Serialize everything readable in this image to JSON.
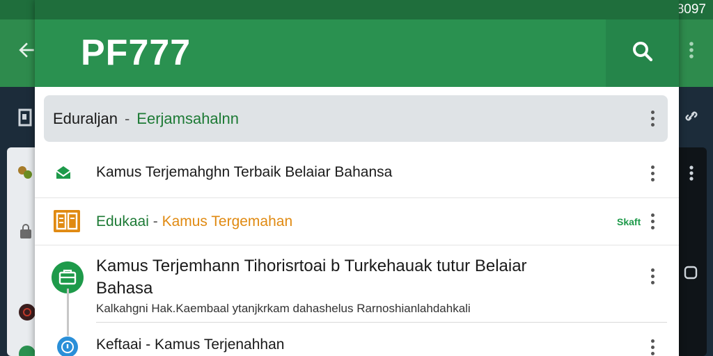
{
  "status_bar": {
    "time": "8097"
  },
  "app_bar": {
    "title": "PF777",
    "search_icon": "search-icon",
    "menu_icon": "more-vert-icon"
  },
  "filter_bar": {
    "title": "Eduraljan",
    "separator": "-",
    "subtitle": "Eerjamsahalnn"
  },
  "items": [
    {
      "title": "Kamus Terjemahghn Terbaik  Belaiar Bahansa",
      "icon": "mail-icon"
    },
    {
      "title_prefix": "Edukaai",
      "separator": "-",
      "title_suffix": "Kamus Tergemahan",
      "badge": "Skaft",
      "icon": "book-icon"
    },
    {
      "title_line1": "Kamus Terjemhann Tihorisrtoai b Turkehauak tutur Belaiar",
      "title_line2": "Bahasa",
      "subtitle": "Kalkahgni Hak.Kaembaal ytanjkrkam dahashelus Rarnoshianlahdahkali",
      "icon": "briefcase-icon"
    },
    {
      "title": "Keftaai - Kamus Terjenahhan",
      "icon": "info-icon"
    }
  ],
  "colors": {
    "primary": "#2a9150",
    "primary_dark": "#1f6e3c",
    "accent_green": "#1d7a35",
    "orange": "#e08a12",
    "badge_green": "#1e9a4a",
    "blue": "#2a8fd8"
  }
}
